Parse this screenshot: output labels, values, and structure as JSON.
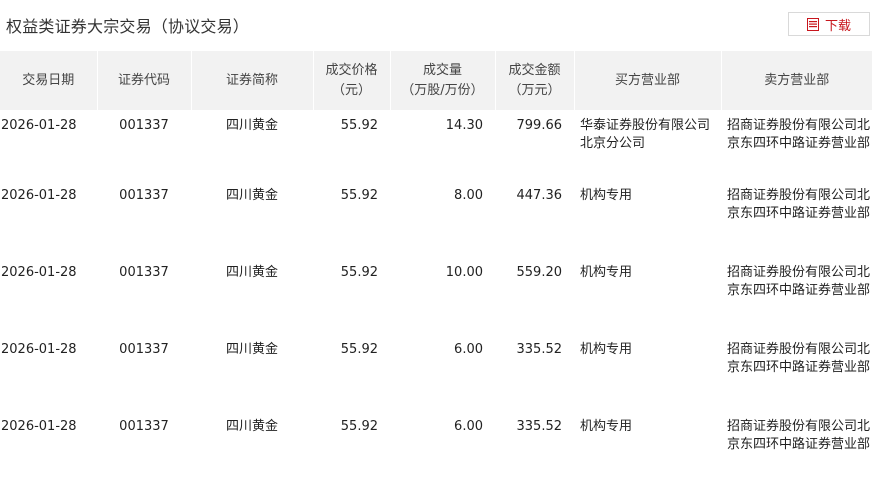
{
  "header": {
    "title": "权益类证券大宗交易（协议交易）",
    "download_label": "下载"
  },
  "table": {
    "columns": [
      {
        "label": "交易日期",
        "sub": ""
      },
      {
        "label": "证券代码",
        "sub": ""
      },
      {
        "label": "证券简称",
        "sub": ""
      },
      {
        "label": "成交价格",
        "sub": "（元）"
      },
      {
        "label": "成交量",
        "sub": "（万股/万份）"
      },
      {
        "label": "成交金额",
        "sub": "（万元）"
      },
      {
        "label": "买方营业部",
        "sub": ""
      },
      {
        "label": "卖方营业部",
        "sub": ""
      }
    ],
    "rows": [
      {
        "date": "2026-01-28",
        "code": "001337",
        "name": "四川黄金",
        "price": "55.92",
        "volume": "14.30",
        "amount": "799.66",
        "buyer": "华泰证券股份有限公司北京分公司",
        "seller": "招商证券股份有限公司北京东四环中路证券营业部"
      },
      {
        "date": "2026-01-28",
        "code": "001337",
        "name": "四川黄金",
        "price": "55.92",
        "volume": "8.00",
        "amount": "447.36",
        "buyer": "机构专用",
        "seller": "招商证券股份有限公司北京东四环中路证券营业部"
      },
      {
        "date": "2026-01-28",
        "code": "001337",
        "name": "四川黄金",
        "price": "55.92",
        "volume": "10.00",
        "amount": "559.20",
        "buyer": "机构专用",
        "seller": "招商证券股份有限公司北京东四环中路证券营业部"
      },
      {
        "date": "2026-01-28",
        "code": "001337",
        "name": "四川黄金",
        "price": "55.92",
        "volume": "6.00",
        "amount": "335.52",
        "buyer": "机构专用",
        "seller": "招商证券股份有限公司北京东四环中路证券营业部"
      },
      {
        "date": "2026-01-28",
        "code": "001337",
        "name": "四川黄金",
        "price": "55.92",
        "volume": "6.00",
        "amount": "335.52",
        "buyer": "机构专用",
        "seller": "招商证券股份有限公司北京东四环中路证券营业部"
      }
    ]
  },
  "colors": {
    "header_bg": "#f2f2f2",
    "accent": "#c8161d"
  }
}
